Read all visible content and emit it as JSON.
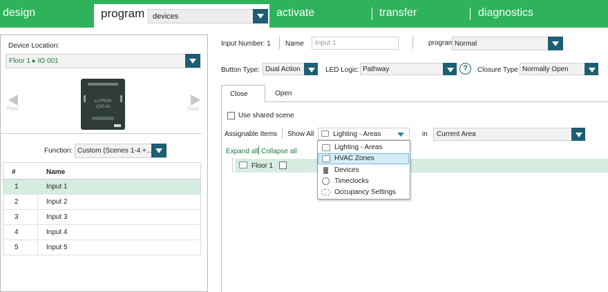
{
  "nav": {
    "design": "design",
    "program": "program",
    "device_select": "devices",
    "activate": "activate",
    "transfer": "transfer",
    "diagnostics": "diagnostics"
  },
  "left": {
    "device_location_label": "Device Location:",
    "device_location_value": "Floor 1 ▸ IO 001",
    "prev_label": "Prev",
    "next_label": "Next",
    "device_image_text": [
      "LUTRON",
      "QSE-IO"
    ],
    "function_label": "Function:",
    "function_value": "Custom (Scenes 1-4 +...",
    "table": {
      "headers": [
        "#",
        "Name"
      ],
      "rows": [
        {
          "num": "1",
          "name": "Input 1"
        },
        {
          "num": "2",
          "name": "Input 2"
        },
        {
          "num": "3",
          "name": "Input 3"
        },
        {
          "num": "4",
          "name": "Input 4"
        },
        {
          "num": "5",
          "name": "Input 5"
        }
      ]
    }
  },
  "right": {
    "input_number_label": "Input Number: 1",
    "name_label": "Name",
    "name_value": "Input 1",
    "program_label": "program",
    "program_value": "Normal",
    "button_type_label": "Button Type:",
    "button_type_value": "Dual Action",
    "led_logic_label": "LED Logic:",
    "led_logic_value": "Pathway",
    "help_label": "?",
    "closure_type_label": "Closure Type",
    "closure_type_value": "Normally Open",
    "tabs": [
      "Close",
      "Open"
    ],
    "use_shared_scene": "Use shared scene",
    "assignable_items_label": "Assignable Items",
    "show_all_label": "Show All",
    "filter_value": "Lighting - Areas",
    "in_label": "in",
    "area_value": "Current Area",
    "expand_all": "Expand all",
    "collapse_all": "Collapse all",
    "tree_node": "Floor 1",
    "menu_items": [
      {
        "label": "Lighting - Areas",
        "icon": "folder-icon"
      },
      {
        "label": "HVAC Zones",
        "icon": "folder-icon"
      },
      {
        "label": "Devices",
        "icon": "device-icon"
      },
      {
        "label": "Timeclocks",
        "icon": "clock-icon"
      },
      {
        "label": "Occupancy Settings",
        "icon": "occupancy-icon"
      }
    ]
  },
  "colors": {
    "nav_green": "#2eb35a",
    "dropdown_teal": "#1c5e73",
    "selected_row": "#d6ece1",
    "menu_highlight": "#d6ecf7"
  }
}
